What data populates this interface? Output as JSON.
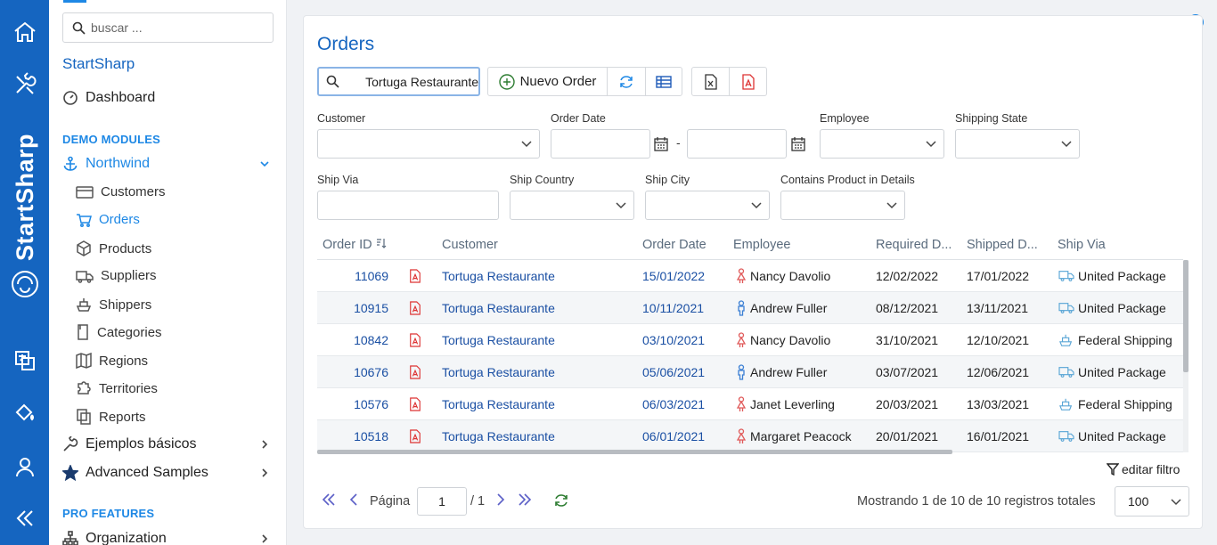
{
  "sidebar": {
    "search_placeholder": "buscar ...",
    "brand": "StartSharp",
    "rail_brand": "StartSharp",
    "dashboard": "Dashboard",
    "demo_section": "DEMO MODULES",
    "northwind": "Northwind",
    "items": [
      {
        "label": "Customers"
      },
      {
        "label": "Orders"
      },
      {
        "label": "Products"
      },
      {
        "label": "Suppliers"
      },
      {
        "label": "Shippers"
      },
      {
        "label": "Categories"
      },
      {
        "label": "Regions"
      },
      {
        "label": "Territories"
      },
      {
        "label": "Reports"
      }
    ],
    "basic_samples": "Ejemplos básicos",
    "advanced_samples": "Advanced Samples",
    "pro_section": "PRO FEATURES",
    "organization": "Organization"
  },
  "page": {
    "title": "Orders",
    "quick_search_value": "Tortuga Restaurante",
    "new_button": "Nuevo Order"
  },
  "filters": {
    "customer": "Customer",
    "order_date": "Order Date",
    "date_sep": "-",
    "employee": "Employee",
    "shipping_state": "Shipping State",
    "ship_via": "Ship Via",
    "ship_country": "Ship Country",
    "ship_city": "Ship City",
    "contains_product": "Contains Product in Details"
  },
  "grid": {
    "headers": {
      "order_id": "Order ID",
      "customer": "Customer",
      "order_date": "Order Date",
      "employee": "Employee",
      "required": "Required D...",
      "shipped": "Shipped D...",
      "ship_via": "Ship Via"
    },
    "rows": [
      {
        "id": "11069",
        "customer": "Tortuga Restaurante",
        "order_date": "15/01/2022",
        "employee": "Nancy Davolio",
        "gender": "female",
        "required": "12/02/2022",
        "shipped": "17/01/2022",
        "ship_via": "United Package",
        "ship_icon": "truck-icon"
      },
      {
        "id": "10915",
        "customer": "Tortuga Restaurante",
        "order_date": "10/11/2021",
        "employee": "Andrew Fuller",
        "gender": "male",
        "required": "08/12/2021",
        "shipped": "13/11/2021",
        "ship_via": "United Package",
        "ship_icon": "truck-icon"
      },
      {
        "id": "10842",
        "customer": "Tortuga Restaurante",
        "order_date": "03/10/2021",
        "employee": "Nancy Davolio",
        "gender": "female",
        "required": "31/10/2021",
        "shipped": "12/10/2021",
        "ship_via": "Federal Shipping",
        "ship_icon": "ship-icon"
      },
      {
        "id": "10676",
        "customer": "Tortuga Restaurante",
        "order_date": "05/06/2021",
        "employee": "Andrew Fuller",
        "gender": "male",
        "required": "03/07/2021",
        "shipped": "12/06/2021",
        "ship_via": "United Package",
        "ship_icon": "truck-icon"
      },
      {
        "id": "10576",
        "customer": "Tortuga Restaurante",
        "order_date": "06/03/2021",
        "employee": "Janet Leverling",
        "gender": "female",
        "required": "20/03/2021",
        "shipped": "13/03/2021",
        "ship_via": "Federal Shipping",
        "ship_icon": "ship-icon"
      },
      {
        "id": "10518",
        "customer": "Tortuga Restaurante",
        "order_date": "06/01/2021",
        "employee": "Margaret Peacock",
        "gender": "female",
        "required": "20/01/2021",
        "shipped": "16/01/2021",
        "ship_via": "United Package",
        "ship_icon": "truck-icon"
      }
    ],
    "edit_filter": "editar filtro"
  },
  "pager": {
    "page_label": "Página",
    "page_value": "1",
    "page_total": "/ 1",
    "status": "Mostrando 1 de 10 de 10 registros totales",
    "page_size": "100"
  },
  "colors": {
    "rail": "#1565c0",
    "accent": "#1e88e5",
    "link": "#1a4fa3",
    "pdf": "#dd3333",
    "female": "#e05a5a",
    "male": "#3b7fd4"
  }
}
